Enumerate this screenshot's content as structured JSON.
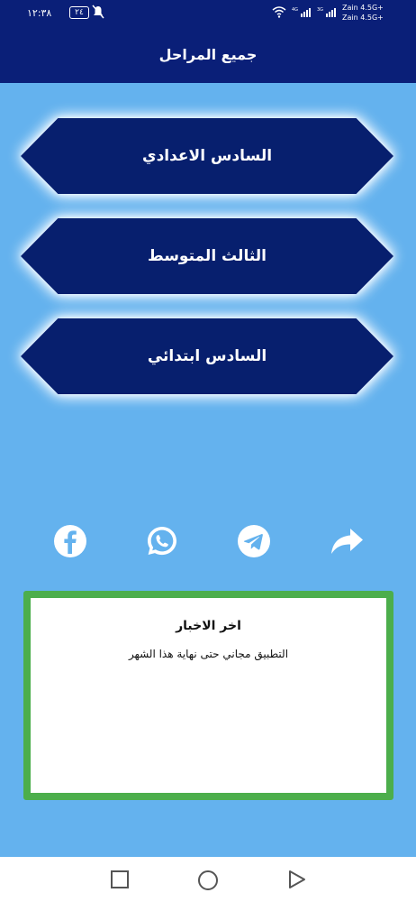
{
  "status_bar": {
    "time": "١٢:٣٨",
    "battery": "٢٤",
    "carrier_1": "Zain 4.5G+",
    "carrier_2": "Zain 4.5G+",
    "network_badge_1": "4G",
    "network_badge_2": "3G"
  },
  "header": {
    "title": "جميع المراحل"
  },
  "stages": [
    {
      "label": "السادس الاعدادي"
    },
    {
      "label": "الثالث المتوسط"
    },
    {
      "label": "السادس ابتدائي"
    }
  ],
  "social": {
    "icons": [
      "facebook-icon",
      "whatsapp-icon",
      "telegram-icon",
      "share-icon"
    ]
  },
  "news": {
    "title": "اخر الاخبار",
    "body": "التطبيق  مجاني حتى نهاية هذا الشهر"
  },
  "colors": {
    "background": "#64b2ee",
    "header": "#0a1f78",
    "button": "#071f6e",
    "news_border": "#4cae4c",
    "icon": "#ffffff"
  },
  "nav": {
    "icons": [
      "recents-icon",
      "home-icon",
      "back-icon"
    ]
  }
}
